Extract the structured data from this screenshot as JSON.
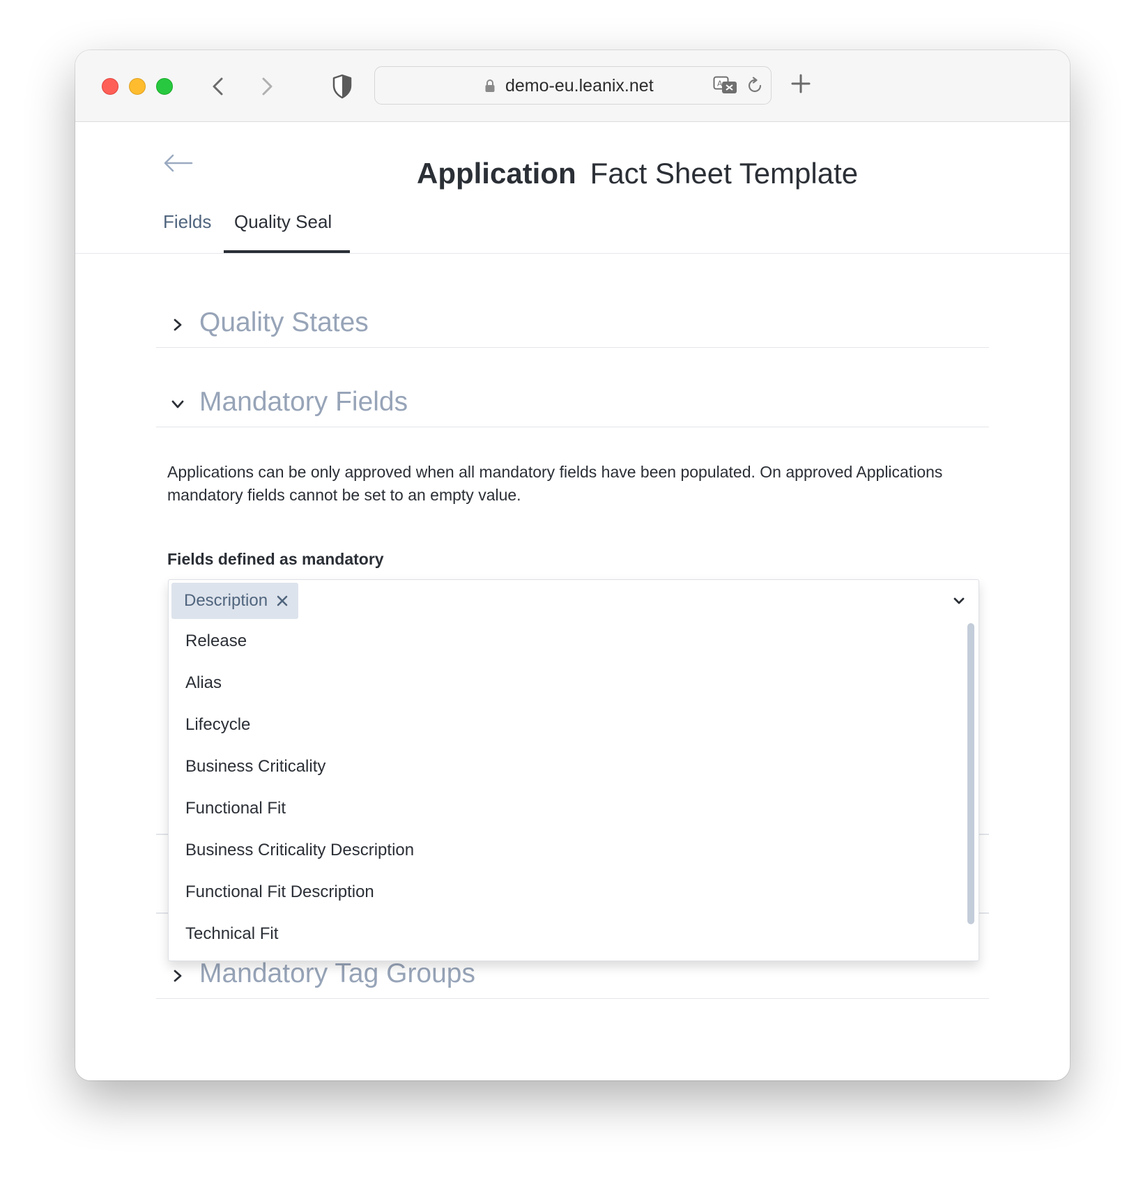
{
  "browser": {
    "url": "demo-eu.leanix.net"
  },
  "page": {
    "title_strong": "Application",
    "title_light": "Fact Sheet Template"
  },
  "tabs": [
    {
      "label": "Fields",
      "active": false
    },
    {
      "label": "Quality Seal",
      "active": true
    }
  ],
  "sections": {
    "quality_states": {
      "title": "Quality States",
      "expanded": false
    },
    "mandatory_fields": {
      "title": "Mandatory Fields",
      "expanded": true,
      "description": "Applications can be only approved when all mandatory fields have been populated. On approved Applications mandatory fields cannot be set to an empty value.",
      "field_label": "Fields defined as mandatory",
      "selected": [
        "Description"
      ],
      "options": [
        "Release",
        "Alias",
        "Lifecycle",
        "Business Criticality",
        "Functional Fit",
        "Business Criticality Description",
        "Functional Fit Description",
        "Technical Fit"
      ]
    },
    "mandatory_tag_groups": {
      "title": "Mandatory Tag Groups",
      "expanded": false
    }
  },
  "colors": {
    "accent_text": "#50657e",
    "section_title": "#97a4b8",
    "chip_bg": "#dde3ec"
  }
}
